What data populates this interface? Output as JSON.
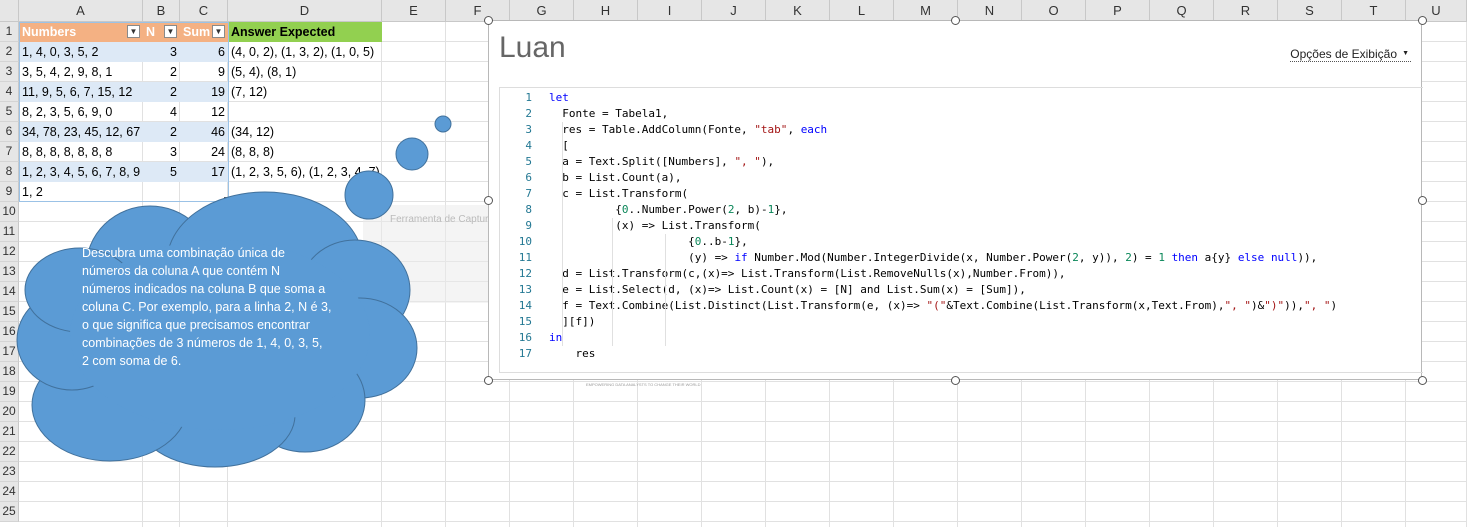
{
  "columns": [
    "A",
    "B",
    "C",
    "D",
    "E",
    "F",
    "G",
    "H",
    "I",
    "J",
    "K",
    "L",
    "M",
    "N",
    "O",
    "P",
    "Q",
    "R",
    "S",
    "T",
    "U"
  ],
  "rows": [
    "1",
    "2",
    "3",
    "4",
    "5",
    "6",
    "7",
    "8",
    "9",
    "10",
    "11",
    "12",
    "13",
    "14",
    "15",
    "16",
    "17",
    "18",
    "19",
    "20",
    "21",
    "22",
    "23",
    "24",
    "25"
  ],
  "table": {
    "headers": {
      "numbers": "Numbers",
      "n": "N",
      "sum": "Sum",
      "answer": "Answer Expected"
    },
    "rows": [
      {
        "numbers": "1, 4, 0, 3, 5, 2",
        "n": "3",
        "sum": "6",
        "answer": "(4, 0, 2), (1, 3, 2), (1, 0, 5)"
      },
      {
        "numbers": "3, 5, 4, 2, 9, 8, 1",
        "n": "2",
        "sum": "9",
        "answer": "(5, 4), (8, 1)"
      },
      {
        "numbers": "11, 9, 5, 6, 7, 15, 12",
        "n": "2",
        "sum": "19",
        "answer": "(7, 12)"
      },
      {
        "numbers": "8, 2, 3, 5, 6, 9, 0",
        "n": "4",
        "sum": "12",
        "answer": ""
      },
      {
        "numbers": "34, 78, 23, 45, 12, 67",
        "n": "2",
        "sum": "46",
        "answer": "(34, 12)"
      },
      {
        "numbers": "8, 8, 8, 8, 8, 8, 8",
        "n": "3",
        "sum": "24",
        "answer": "(8, 8, 8)"
      },
      {
        "numbers": "1, 2, 3, 4, 5, 6, 7, 8, 9",
        "n": "5",
        "sum": "17",
        "answer": "(1, 2, 3, 5, 6), (1, 2, 3, 4, 7)"
      },
      {
        "numbers": "1, 2",
        "n": "",
        "sum": "",
        "answer": ""
      }
    ]
  },
  "cloud_text": "Descubra uma combinação única de números da coluna A que contém N números indicados na coluna B que soma a coluna C. Por exemplo, para a linha 2, N é 3, o que significa que precisamos encontrar combinações de 3 números de 1, 4, 0, 3, 5, 2 com soma de 6.",
  "capture_label": "Ferramenta de Captura",
  "watermark": "EMPOWERING DATA ANALYSTS TO CHANGE THEIR WORLD",
  "editor": {
    "title": "Luan",
    "options_label": "Opções de Exibição",
    "options_icon": "chevron-down-icon"
  },
  "code_lines": [
    [
      {
        "t": "let",
        "c": "kw"
      }
    ],
    [
      {
        "t": "  Fonte = Tabela1,"
      }
    ],
    [
      {
        "t": "  res = Table.AddColumn(Fonte, "
      },
      {
        "t": "\"tab\"",
        "c": "str"
      },
      {
        "t": ", "
      },
      {
        "t": "each",
        "c": "kw"
      }
    ],
    [
      {
        "t": "  ["
      }
    ],
    [
      {
        "t": "  a = Text.Split([Numbers], "
      },
      {
        "t": "\", \"",
        "c": "str"
      },
      {
        "t": "),"
      }
    ],
    [
      {
        "t": "  b = List.Count(a),"
      }
    ],
    [
      {
        "t": "  c = List.Transform("
      }
    ],
    [
      {
        "t": "          {"
      },
      {
        "t": "0",
        "c": "nm"
      },
      {
        "t": "..Number.Power("
      },
      {
        "t": "2",
        "c": "nm"
      },
      {
        "t": ", b)-"
      },
      {
        "t": "1",
        "c": "nm"
      },
      {
        "t": "},"
      }
    ],
    [
      {
        "t": "          (x) => List.Transform("
      }
    ],
    [
      {
        "t": "                     {"
      },
      {
        "t": "0",
        "c": "nm"
      },
      {
        "t": "..b-"
      },
      {
        "t": "1",
        "c": "nm"
      },
      {
        "t": "},"
      }
    ],
    [
      {
        "t": "                     (y) => "
      },
      {
        "t": "if",
        "c": "kw"
      },
      {
        "t": " Number.Mod(Number.IntegerDivide(x, Number.Power("
      },
      {
        "t": "2",
        "c": "nm"
      },
      {
        "t": ", y)), "
      },
      {
        "t": "2",
        "c": "nm"
      },
      {
        "t": ") = "
      },
      {
        "t": "1",
        "c": "nm"
      },
      {
        "t": " "
      },
      {
        "t": "then",
        "c": "kw"
      },
      {
        "t": " a{y} "
      },
      {
        "t": "else",
        "c": "kw"
      },
      {
        "t": " "
      },
      {
        "t": "null",
        "c": "kw"
      },
      {
        "t": ")),"
      }
    ],
    [
      {
        "t": "  d = List.Transform(c,(x)=> List.Transform(List.RemoveNulls(x),Number.From)),"
      }
    ],
    [
      {
        "t": "  e = List.Select(d, (x)=> List.Count(x) = [N] and List.Sum(x) = [Sum]),"
      }
    ],
    [
      {
        "t": "  f = Text.Combine(List.Distinct(List.Transform(e, (x)=> "
      },
      {
        "t": "\"(\"",
        "c": "str"
      },
      {
        "t": "&Text.Combine(List.Transform(x,Text.From),"
      },
      {
        "t": "\", \"",
        "c": "str"
      },
      {
        "t": ")&"
      },
      {
        "t": "\")\"",
        "c": "str"
      },
      {
        "t": ")),"
      },
      {
        "t": "\", \"",
        "c": "str"
      },
      {
        "t": ")"
      }
    ],
    [
      {
        "t": "  ][f])"
      }
    ],
    [
      {
        "t": "in",
        "c": "kw"
      }
    ],
    [
      {
        "t": "    res"
      }
    ]
  ],
  "colors": {
    "header_orange": "#f4b183",
    "header_green": "#92d050",
    "band_blue": "#dde9f6",
    "cloud_blue": "#5b9bd5",
    "cloud_border": "#41719c"
  }
}
